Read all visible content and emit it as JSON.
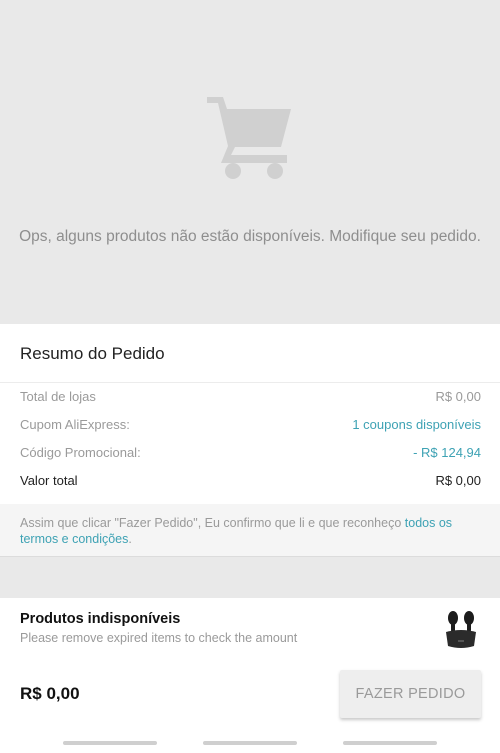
{
  "empty_state": {
    "icon": "shopping-cart-icon",
    "message": "Ops, alguns produtos não estão disponíveis. Modifique seu pedido."
  },
  "summary": {
    "title": "Resumo do Pedido",
    "rows": [
      {
        "label": "Total de lojas",
        "value": "R$ 0,00"
      },
      {
        "label": "Cupom AliExpress:",
        "value": "1 coupons disponíveis"
      },
      {
        "label": "Código Promocional:",
        "value": "- R$ 124,94"
      },
      {
        "label": "Valor total",
        "value": "R$ 0,00"
      }
    ]
  },
  "terms": {
    "text": "Assim que clicar \"Fazer Pedido\", Eu confirmo que li e que reconheço ",
    "link_text": "todos os termos e condições",
    "suffix": "."
  },
  "unavailable": {
    "title": "Produtos indisponíveis",
    "subtitle": "Please remove expired items to check the amount"
  },
  "footer": {
    "total": "R$ 0,00",
    "order_button": "FAZER PEDIDO"
  },
  "colors": {
    "accent": "#3ea2b4",
    "muted_text": "#9a9a9a",
    "background": "#e9e9e9"
  }
}
